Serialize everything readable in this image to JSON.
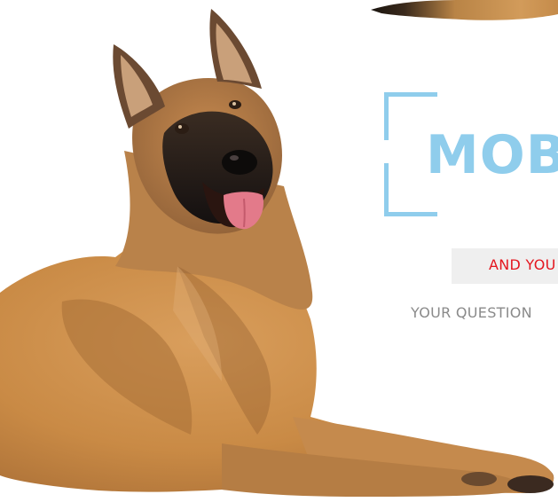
{
  "hero": {
    "headline": "MOBI",
    "subtitle": "AND YOU",
    "question_line": "YOUR QUESTION"
  },
  "colors": {
    "accent_blue": "#8fcdec",
    "subtitle_red": "#e4161f",
    "strip_gray": "#efefef",
    "question_gray": "#8a8a8a",
    "background": "#ffffff"
  },
  "images": {
    "dog": "belgian-malinois-dog-lying",
    "tail": "dog-tail"
  }
}
